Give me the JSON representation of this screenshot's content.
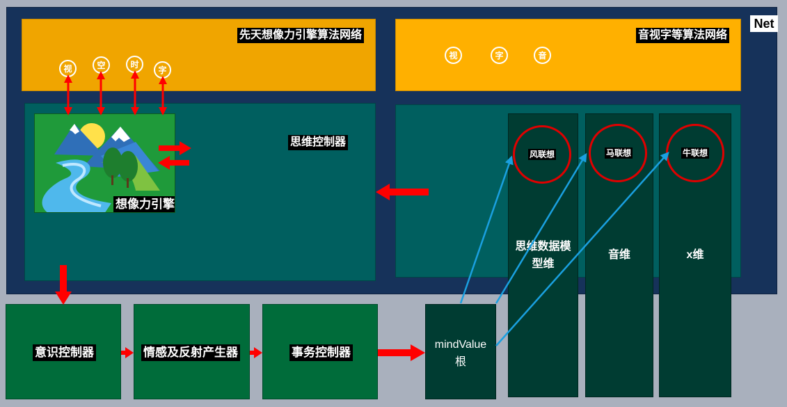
{
  "net_label": "Net",
  "top_left": {
    "title": "先天想像力引擎算法网络",
    "circles": [
      "视",
      "空",
      "时",
      "字"
    ]
  },
  "top_right": {
    "title": "音视字等算法网络",
    "circles": [
      "视",
      "字",
      "音"
    ]
  },
  "thinking_controller": {
    "label": "思维控制器"
  },
  "imagination_engine": {
    "label": "想像力引擎"
  },
  "columns": [
    {
      "label": "思维数据模型维",
      "assoc": "风联想"
    },
    {
      "label": "音维",
      "assoc": "马联想"
    },
    {
      "label": "x维",
      "assoc": "牛联想"
    }
  ],
  "bottom": {
    "consciousness": "意识控制器",
    "emotion": "情感及反射产生器",
    "affairs": "事务控制器",
    "mindvalue_line1": "mindValue",
    "mindvalue_line2": "根"
  },
  "colors": {
    "arrow_red": "#ff0000",
    "arrow_blue": "#1aa0e0",
    "net_bg": "#16325a",
    "orange": "#f0a500"
  }
}
